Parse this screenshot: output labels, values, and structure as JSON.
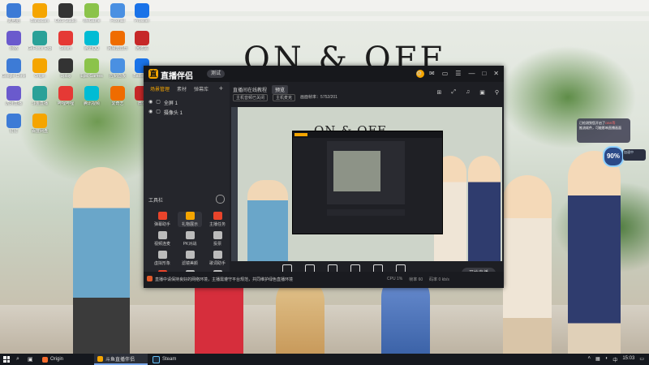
{
  "wallpaper": {
    "title": "ON & OFF"
  },
  "desktop_icons": [
    {
      "label": "此电脑"
    },
    {
      "label": "Bandicam"
    },
    {
      "label": "OBS Studio"
    },
    {
      "label": "WeGame"
    },
    {
      "label": "Foxmail"
    },
    {
      "label": "Proxifier"
    },
    {
      "label": "网络"
    },
    {
      "label": "GeForce Experience"
    },
    {
      "label": "Steam"
    },
    {
      "label": "腾讯QQ"
    },
    {
      "label": "网易云音乐"
    },
    {
      "label": "回收站"
    },
    {
      "label": "Google Chrome"
    },
    {
      "label": "Origin"
    },
    {
      "label": "Uplay"
    },
    {
      "label": "Epic Games"
    },
    {
      "label": "控制面板"
    },
    {
      "label": "Battle.net"
    },
    {
      "label": "虎牙直播"
    },
    {
      "label": "斗鱼直播"
    },
    {
      "label": "哔哩哔哩"
    },
    {
      "label": "腾讯视频"
    },
    {
      "label": "爱奇艺"
    },
    {
      "label": "微信"
    },
    {
      "label": "钉钉"
    },
    {
      "label": "百度网盘"
    }
  ],
  "app": {
    "title": "直播伴侣",
    "version_badge": "测试",
    "title_icons": [
      "⚙",
      "✉",
      "▭",
      "☰",
      "—",
      "□",
      "✕"
    ],
    "left_tabs": [
      {
        "label": "场景管理"
      },
      {
        "label": "素材"
      },
      {
        "label": "弹幕库"
      }
    ],
    "tab_add": "+",
    "sources": [
      {
        "label": "全屏 1"
      },
      {
        "label": "摄像头 1"
      }
    ],
    "tools_heading": "工具栏",
    "tools": [
      {
        "label": "弹幕助手"
      },
      {
        "label": "礼物展示"
      },
      {
        "label": "主播任务"
      },
      {
        "label": "视频连麦"
      },
      {
        "label": "PK对战"
      },
      {
        "label": "投票"
      },
      {
        "label": "虚拟形象"
      },
      {
        "label": "滤镜美颜"
      },
      {
        "label": "歌词助手"
      },
      {
        "label": "更多"
      },
      {
        "label": "录制"
      },
      {
        "label": "设置"
      }
    ],
    "scene": {
      "title": "直播间在线教程",
      "badge": "预览",
      "line2_a": "主机音频已关闭",
      "line2_b": "主机麦克",
      "line2_c": "画面帧率：5752/201"
    },
    "top_right_icons": [
      "⊞",
      "⤢",
      "♫",
      "▣",
      "⚲"
    ],
    "preview_title": "ON & OFF",
    "bottom_actions": [
      {
        "label": "直播屏幕"
      },
      {
        "label": "摄像头"
      },
      {
        "label": "手机投屏"
      },
      {
        "label": "多媒体"
      },
      {
        "label": "麦克风"
      },
      {
        "label": "扬声器"
      }
    ],
    "go_live": "开始直播",
    "notice": "直播中请保持良好的网络环境，主播需遵守平台规范，共同维护绿色直播环境",
    "stats": [
      "CPU 1%",
      "帧率 60",
      "码率 0 kb/s"
    ]
  },
  "popup": {
    "line1": "已检测到您开启了",
    "highlight": "OBS等",
    "line2": "推流软件，可能影响直播画面"
  },
  "speed": {
    "value": "90%",
    "tag": "加速中"
  },
  "taskbar": {
    "items": [
      {
        "label": "Origin"
      },
      {
        "label": "斗鱼直播伴侣"
      },
      {
        "label": "Steam"
      }
    ],
    "tray": {
      "lang": "中",
      "time": "15:03"
    }
  }
}
